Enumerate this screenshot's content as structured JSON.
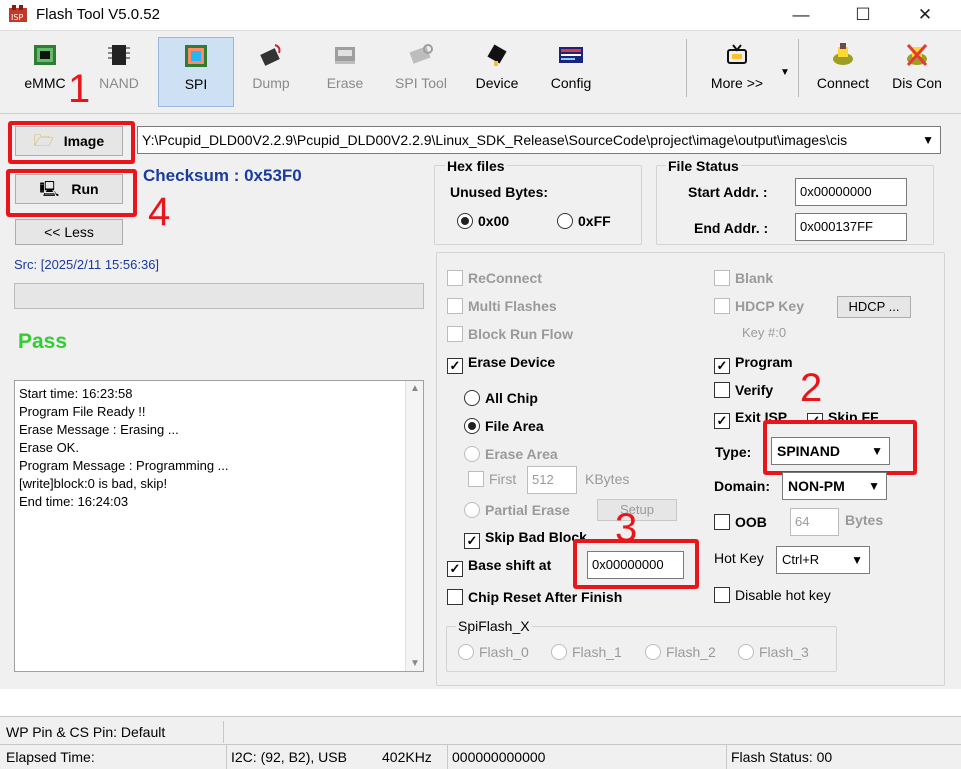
{
  "window": {
    "title": "Flash Tool V5.0.52",
    "controls": {
      "minimize": "—",
      "maximize": "☐",
      "close": "✕"
    }
  },
  "toolbar": {
    "items": [
      {
        "label": "eMMC",
        "icon": "emmc-chip-icon",
        "enabled": true
      },
      {
        "label": "NAND",
        "icon": "nand-chip-icon",
        "enabled": false
      },
      {
        "label": "SPI",
        "icon": "spi-icon",
        "enabled": true,
        "selected": true
      },
      {
        "label": "Dump",
        "icon": "dump-icon",
        "enabled": false
      },
      {
        "label": "Erase",
        "icon": "erase-icon",
        "enabled": false
      },
      {
        "label": "SPI Tool",
        "icon": "spi-tool-icon",
        "enabled": false
      },
      {
        "label": "Device",
        "icon": "device-icon",
        "enabled": true
      },
      {
        "label": "Config",
        "icon": "config-icon",
        "enabled": true
      },
      {
        "label": "More >>",
        "icon": "more-icon",
        "enabled": true
      },
      {
        "label": "Connect",
        "icon": "connect-icon",
        "enabled": true
      },
      {
        "label": "Dis Con",
        "icon": "disconnect-icon",
        "enabled": true
      }
    ]
  },
  "annotations": {
    "n1": "1",
    "n2": "2",
    "n3": "3",
    "n4": "4",
    "color": "#e8151b"
  },
  "image_path": {
    "button_label": "Image",
    "value": "Y:\\Pcupid_DLD00V2.2.9\\Pcupid_DLD00V2.2.9\\Linux_SDK_Release\\SourceCode\\project\\image\\output\\images\\cis"
  },
  "run": {
    "label": "Run"
  },
  "less": {
    "label": "<< Less"
  },
  "checksum": "Checksum : 0x53F0",
  "src": "Src: [2025/2/11 15:56:36]",
  "result": {
    "text": "Pass",
    "color": "#32cd32"
  },
  "log": [
    "Start time: 16:23:58",
    "Program File Ready !!",
    "Erase Message : Erasing ...",
    "Erase OK.",
    "Program Message : Programming ...",
    "[write]block:0 is bad, skip!",
    "End time: 16:24:03"
  ],
  "hex_files": {
    "title": "Hex files",
    "unused_label": "Unused Bytes:",
    "opt1": "0x00",
    "opt2": "0xFF"
  },
  "file_status": {
    "title": "File Status",
    "start_label": "Start Addr. :",
    "start_value": "0x00000000",
    "end_label": "End Addr. :",
    "end_value": "0x000137FF"
  },
  "options_left": {
    "reconnect": "ReConnect",
    "multi_flashes": "Multi Flashes",
    "block_run_flow": "Block Run Flow",
    "erase_device": "Erase Device",
    "all_chip": "All Chip",
    "file_area": "File Area",
    "erase_area": "Erase Area",
    "first": "First",
    "first_value": "512",
    "kbytes": "KBytes",
    "partial_erase": "Partial Erase",
    "setup": "Setup",
    "skip_bad_block": "Skip Bad Block",
    "base_shift": "Base shift at",
    "base_shift_value": "0x00000000",
    "chip_reset": "Chip Reset After Finish"
  },
  "options_right": {
    "blank": "Blank",
    "hdcp_key": "HDCP Key",
    "hdcp_btn": "HDCP ...",
    "key_num": "Key #:0",
    "program": "Program",
    "verify": "Verify",
    "exit_isp": "Exit ISP",
    "skip_ff": "Skip FF",
    "type_label": "Type:",
    "type_value": "SPINAND",
    "domain_label": "Domain:",
    "domain_value": "NON-PM",
    "oob": "OOB",
    "oob_value": "64",
    "bytes": "Bytes",
    "hotkey_label": "Hot Key",
    "hotkey_value": "Ctrl+R",
    "disable_hotkey": "Disable hot key"
  },
  "spiflash": {
    "title": "SpiFlash_X",
    "options": [
      "Flash_0",
      "Flash_1",
      "Flash_2",
      "Flash_3"
    ]
  },
  "statusbar": {
    "pins": "WP Pin & CS Pin: Default",
    "elapsed": "Elapsed Time:",
    "i2c": "I2C: (92, B2), USB",
    "speed": "402KHz",
    "counter": "000000000000",
    "flash_status": "Flash Status: 00"
  }
}
